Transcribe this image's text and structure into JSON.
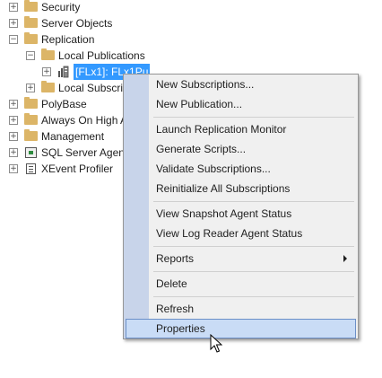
{
  "tree": {
    "security": "Security",
    "server_objects": "Server Objects",
    "replication": "Replication",
    "local_publications": "Local Publications",
    "publication_node": "[FLx1]: FLx1Pu",
    "local_subscriptions": "Local Subscrip",
    "polybase": "PolyBase",
    "always_on": "Always On High A",
    "management": "Management",
    "sql_agent": "SQL Server Agent",
    "xevent": "XEvent Profiler",
    "expand_glyph": "+",
    "collapse_glyph": "−"
  },
  "context_menu": {
    "new_subscriptions": "New Subscriptions...",
    "new_publication": "New Publication...",
    "launch_monitor": "Launch Replication Monitor",
    "generate_scripts": "Generate Scripts...",
    "validate_subscriptions": "Validate Subscriptions...",
    "reinitialize": "Reinitialize All Subscriptions",
    "view_snapshot": "View Snapshot Agent Status",
    "view_log_reader": "View Log Reader Agent Status",
    "reports": "Reports",
    "delete": "Delete",
    "refresh": "Refresh",
    "properties": "Properties"
  },
  "colors": {
    "selection": "#3399ff",
    "menu_hover": "#c9dcf6",
    "menu_gutter": "#c8d4ea",
    "folder": "#dcb567"
  }
}
